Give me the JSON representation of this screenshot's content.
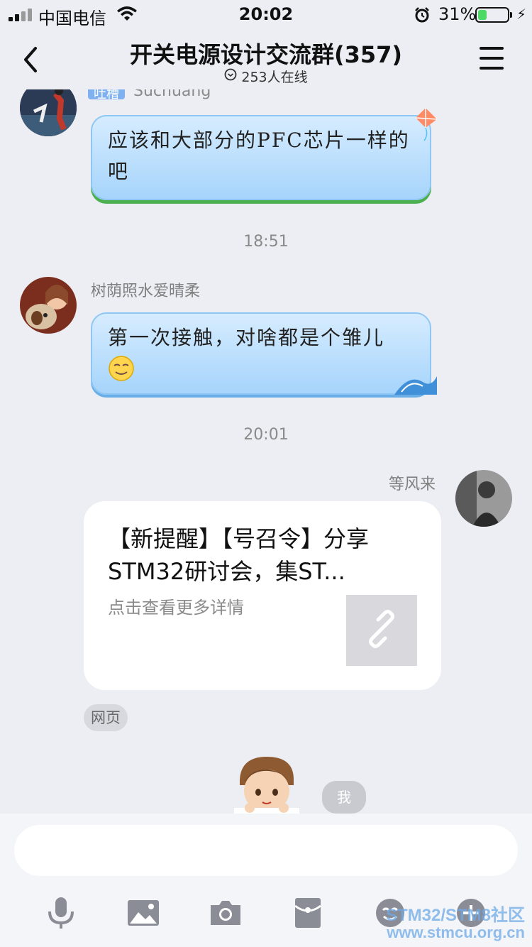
{
  "status_bar": {
    "carrier": "中国电信",
    "time": "20:02",
    "battery_percent": "31%",
    "battery_level": 0.31,
    "icons": [
      "signal-icon",
      "wifi-icon",
      "alarm-icon",
      "battery-icon",
      "charging-icon"
    ]
  },
  "nav": {
    "title": "开关电源设计交流群(357)",
    "online": "253人在线",
    "icons": [
      "back-icon",
      "online-icon",
      "menu-icon"
    ]
  },
  "messages": {
    "first": {
      "badge": "吐槽",
      "sender": "Suchuang",
      "text": "应该和大部分的PFC芯片一样的吧"
    },
    "time1": "18:51",
    "second": {
      "sender": "树荫照水爱晴柔",
      "text": "第一次接触，对啥都是个雏儿",
      "emoji": "smile-emoji"
    },
    "time2": "20:01",
    "third": {
      "sender": "等风来",
      "card_title": "【新提醒】【号召令】分享STM32研讨会，集ST...",
      "card_desc": "点击查看更多详情",
      "card_tag": "网页",
      "thumb_icon": "link-icon"
    },
    "me_tag": "我"
  },
  "input": {
    "placeholder": "",
    "tools": [
      "microphone-icon",
      "image-icon",
      "camera-icon",
      "red-packet-icon",
      "emoji-icon",
      "plus-icon"
    ]
  },
  "watermark": {
    "line1": "STM32/STM8社区",
    "line2": "www.stmcu.org.cn"
  },
  "colors": {
    "background": "#edeef4",
    "bubble_blue": "#a6d4fb",
    "card": "#ffffff"
  }
}
